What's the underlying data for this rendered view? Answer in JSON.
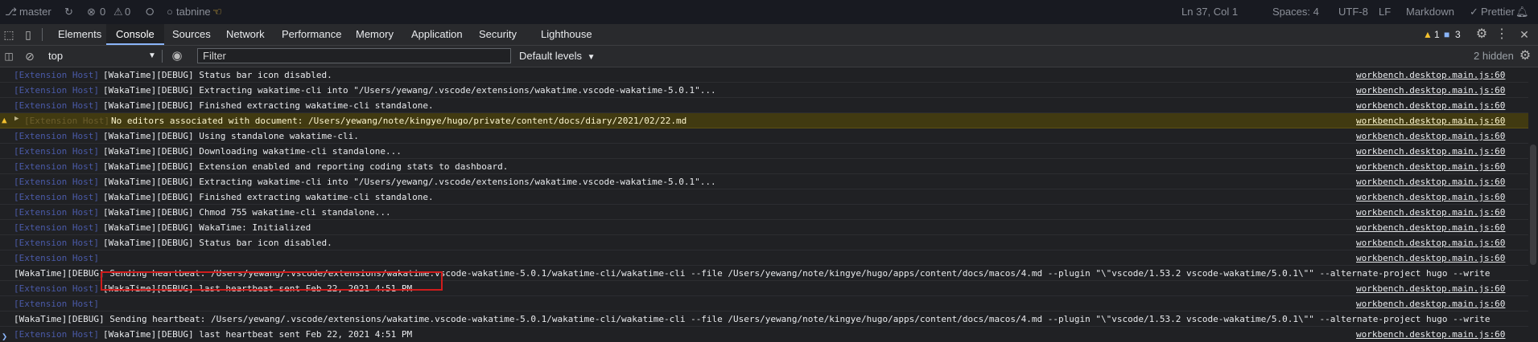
{
  "statusbar": {
    "branch": "master",
    "errors": "0",
    "warnings": "0",
    "tabnine": "tabnine",
    "position": "Ln 37, Col 1",
    "spaces": "Spaces: 4",
    "encoding": "UTF-8",
    "eol": "LF",
    "language": "Markdown",
    "prettier": "Prettier"
  },
  "devtools": {
    "tabs": [
      "Elements",
      "Console",
      "Sources",
      "Network",
      "Performance",
      "Memory",
      "Application",
      "Security",
      "Lighthouse"
    ],
    "active_tab": "Console",
    "warn_count": "1",
    "msg_count": "3"
  },
  "console_toolbar": {
    "context": "top",
    "filter_placeholder": "Filter",
    "levels": "Default levels",
    "hidden": "2 hidden"
  },
  "log": [
    {
      "type": "debug",
      "context": "[Extension Host]",
      "message": "[WakaTime][DEBUG] Status bar icon disabled.",
      "source": "workbench.desktop.main.js:60"
    },
    {
      "type": "debug",
      "context": "[Extension Host]",
      "message": "[WakaTime][DEBUG] Extracting wakatime-cli into \"/Users/yewang/.vscode/extensions/wakatime.vscode-wakatime-5.0.1\"...",
      "source": "workbench.desktop.main.js:60"
    },
    {
      "type": "debug",
      "context": "[Extension Host]",
      "message": "[WakaTime][DEBUG] Finished extracting wakatime-cli standalone.",
      "source": "workbench.desktop.main.js:60"
    },
    {
      "type": "warn",
      "context": "[Extension Host]",
      "message": "No editors associated with document: /Users/yewang/note/kingye/hugo/private/content/docs/diary/2021/02/22.md",
      "source": "workbench.desktop.main.js:60"
    },
    {
      "type": "debug",
      "context": "[Extension Host]",
      "message": "[WakaTime][DEBUG] Using standalone wakatime-cli.",
      "source": "workbench.desktop.main.js:60"
    },
    {
      "type": "debug",
      "context": "[Extension Host]",
      "message": "[WakaTime][DEBUG] Downloading wakatime-cli standalone...",
      "source": "workbench.desktop.main.js:60"
    },
    {
      "type": "debug",
      "context": "[Extension Host]",
      "message": "[WakaTime][DEBUG] Extension enabled and reporting coding stats to dashboard.",
      "source": "workbench.desktop.main.js:60"
    },
    {
      "type": "debug",
      "context": "[Extension Host]",
      "message": "[WakaTime][DEBUG] Extracting wakatime-cli into \"/Users/yewang/.vscode/extensions/wakatime.vscode-wakatime-5.0.1\"...",
      "source": "workbench.desktop.main.js:60"
    },
    {
      "type": "debug",
      "context": "[Extension Host]",
      "message": "[WakaTime][DEBUG] Finished extracting wakatime-cli standalone.",
      "source": "workbench.desktop.main.js:60"
    },
    {
      "type": "debug",
      "context": "[Extension Host]",
      "message": "[WakaTime][DEBUG] Chmod 755 wakatime-cli standalone...",
      "source": "workbench.desktop.main.js:60"
    },
    {
      "type": "debug",
      "context": "[Extension Host]",
      "message": "[WakaTime][DEBUG] WakaTime: Initialized",
      "source": "workbench.desktop.main.js:60"
    },
    {
      "type": "debug",
      "context": "[Extension Host]",
      "message": "[WakaTime][DEBUG] Status bar icon disabled.",
      "source": "workbench.desktop.main.js:60"
    },
    {
      "type": "debug",
      "context": "[Extension Host]",
      "message": "",
      "source": "workbench.desktop.main.js:60"
    },
    {
      "type": "full",
      "context": "",
      "message": "[WakaTime][DEBUG] Sending heartbeat: /Users/yewang/.vscode/extensions/wakatime.vscode-wakatime-5.0.1/wakatime-cli/wakatime-cli --file /Users/yewang/note/kingye/hugo/apps/content/docs/macos/4.md --plugin \"\\\"vscode/1.53.2 vscode-wakatime/5.0.1\\\"\" --alternate-project hugo --write",
      "source": ""
    },
    {
      "type": "debug",
      "context": "[Extension Host]",
      "message": "[WakaTime][DEBUG] last heartbeat sent Feb 22, 2021 4:51 PM",
      "source": "workbench.desktop.main.js:60"
    },
    {
      "type": "debug",
      "context": "[Extension Host]",
      "message": "",
      "source": "workbench.desktop.main.js:60"
    },
    {
      "type": "full",
      "context": "",
      "message": "[WakaTime][DEBUG] Sending heartbeat: /Users/yewang/.vscode/extensions/wakatime.vscode-wakatime-5.0.1/wakatime-cli/wakatime-cli --file /Users/yewang/note/kingye/hugo/apps/content/docs/macos/4.md --plugin \"\\\"vscode/1.53.2 vscode-wakatime/5.0.1\\\"\" --alternate-project hugo --write",
      "source": ""
    },
    {
      "type": "debug",
      "context": "[Extension Host]",
      "message": "[WakaTime][DEBUG] last heartbeat sent Feb 22, 2021 4:51 PM",
      "source": "workbench.desktop.main.js:60"
    }
  ],
  "colors": {
    "accent": "#8ab4f8",
    "warning": "#f2c02f",
    "highlight_box": "#d01c1c"
  }
}
